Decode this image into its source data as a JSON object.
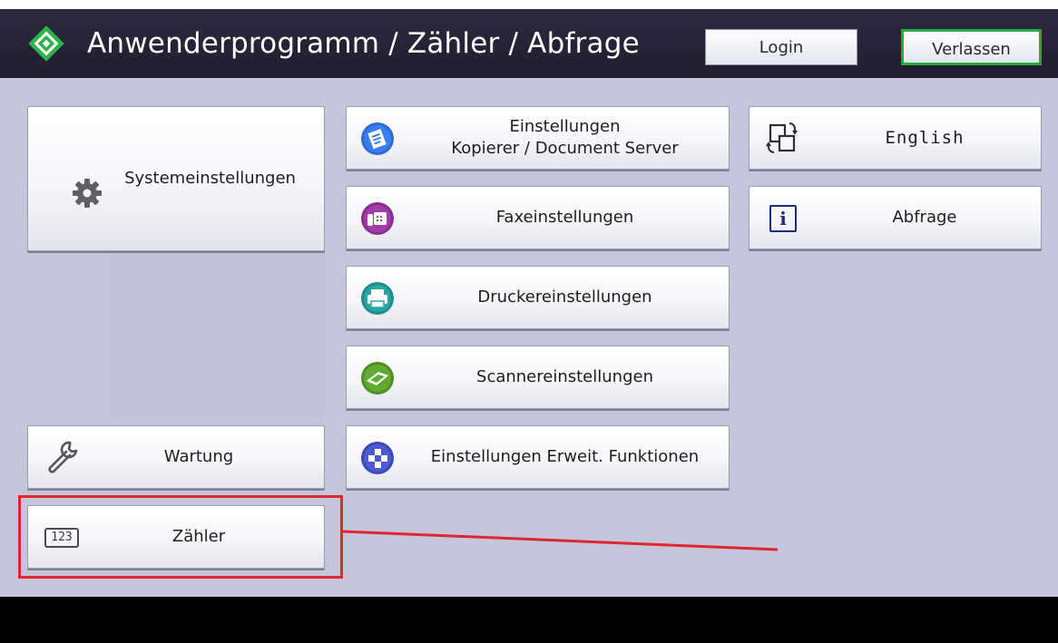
{
  "header": {
    "title": "Anwenderprogramm / Zähler / Abfrage",
    "login_label": "Login",
    "exit_label": "Verlassen"
  },
  "menu": {
    "system_settings": "Systemeinstellungen",
    "copier_settings_line1": "Einstellungen",
    "copier_settings_line2": "Kopierer / Document Server",
    "fax_settings": "Faxeinstellungen",
    "printer_settings": "Druckereinstellungen",
    "scanner_settings": "Scannereinstellungen",
    "extended_settings": "Einstellungen Erweit. Funktionen",
    "maintenance": "Wartung",
    "counter": "Zähler",
    "language": "English",
    "inquiry": "Abfrage"
  },
  "counter_icon_text": "123",
  "inquiry_icon_text": "i",
  "icons": {
    "logo": "diamond-logo-icon",
    "system": "gear-icon",
    "copier": "copier-icon",
    "fax": "fax-icon",
    "printer": "printer-icon",
    "scanner": "scanner-icon",
    "extended": "extended-functions-icon",
    "maintenance": "wrench-icon",
    "counter": "counter-icon",
    "language": "language-switch-icon",
    "inquiry": "info-icon"
  },
  "colors": {
    "header_bg": "#2c2a3d",
    "panel_bg": "#c5c5db",
    "exit_border": "#28a83d",
    "highlight": "#e0262e",
    "logo_green": "#2fb24a"
  }
}
